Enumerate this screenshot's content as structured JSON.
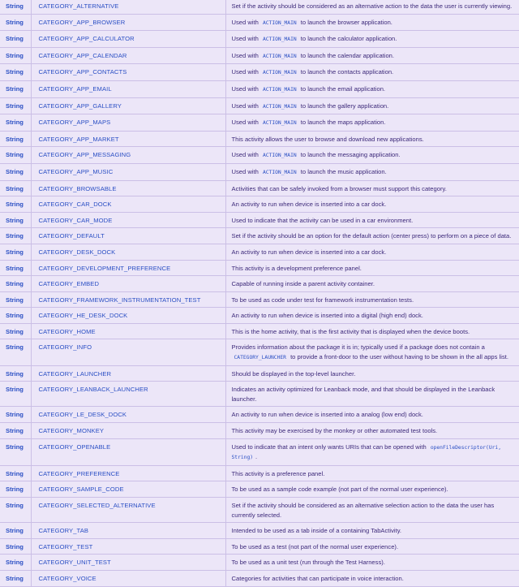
{
  "rows": [
    {
      "type": "String",
      "name": "CATEGORY_ALTERNATIVE",
      "desc": [
        "Set if the activity should be considered as an alternative action to the data the user is currently viewing."
      ]
    },
    {
      "type": "String",
      "name": "CATEGORY_APP_BROWSER",
      "desc": [
        "Used with ",
        {
          "code": "ACTION_MAIN"
        },
        " to launch the browser application."
      ]
    },
    {
      "type": "String",
      "name": "CATEGORY_APP_CALCULATOR",
      "desc": [
        "Used with ",
        {
          "code": "ACTION_MAIN"
        },
        " to launch the calculator application."
      ]
    },
    {
      "type": "String",
      "name": "CATEGORY_APP_CALENDAR",
      "desc": [
        "Used with ",
        {
          "code": "ACTION_MAIN"
        },
        " to launch the calendar application."
      ]
    },
    {
      "type": "String",
      "name": "CATEGORY_APP_CONTACTS",
      "desc": [
        "Used with ",
        {
          "code": "ACTION_MAIN"
        },
        " to launch the contacts application."
      ]
    },
    {
      "type": "String",
      "name": "CATEGORY_APP_EMAIL",
      "desc": [
        "Used with ",
        {
          "code": "ACTION_MAIN"
        },
        " to launch the email application."
      ]
    },
    {
      "type": "String",
      "name": "CATEGORY_APP_GALLERY",
      "desc": [
        "Used with ",
        {
          "code": "ACTION_MAIN"
        },
        " to launch the gallery application."
      ]
    },
    {
      "type": "String",
      "name": "CATEGORY_APP_MAPS",
      "desc": [
        "Used with ",
        {
          "code": "ACTION_MAIN"
        },
        " to launch the maps application."
      ]
    },
    {
      "type": "String",
      "name": "CATEGORY_APP_MARKET",
      "desc": [
        "This activity allows the user to browse and download new applications."
      ]
    },
    {
      "type": "String",
      "name": "CATEGORY_APP_MESSAGING",
      "desc": [
        "Used with ",
        {
          "code": "ACTION_MAIN"
        },
        " to launch the messaging application."
      ]
    },
    {
      "type": "String",
      "name": "CATEGORY_APP_MUSIC",
      "desc": [
        "Used with ",
        {
          "code": "ACTION_MAIN"
        },
        " to launch the music application."
      ]
    },
    {
      "type": "String",
      "name": "CATEGORY_BROWSABLE",
      "desc": [
        "Activities that can be safely invoked from a browser must support this category."
      ]
    },
    {
      "type": "String",
      "name": "CATEGORY_CAR_DOCK",
      "desc": [
        "An activity to run when device is inserted into a car dock."
      ]
    },
    {
      "type": "String",
      "name": "CATEGORY_CAR_MODE",
      "desc": [
        "Used to indicate that the activity can be used in a car environment."
      ]
    },
    {
      "type": "String",
      "name": "CATEGORY_DEFAULT",
      "desc": [
        "Set if the activity should be an option for the default action (center press) to perform on a piece of data."
      ]
    },
    {
      "type": "String",
      "name": "CATEGORY_DESK_DOCK",
      "desc": [
        "An activity to run when device is inserted into a car dock."
      ]
    },
    {
      "type": "String",
      "name": "CATEGORY_DEVELOPMENT_PREFERENCE",
      "desc": [
        "This activity is a development preference panel."
      ]
    },
    {
      "type": "String",
      "name": "CATEGORY_EMBED",
      "desc": [
        "Capable of running inside a parent activity container."
      ]
    },
    {
      "type": "String",
      "name": "CATEGORY_FRAMEWORK_INSTRUMENTATION_TEST",
      "desc": [
        "To be used as code under test for framework instrumentation tests."
      ]
    },
    {
      "type": "String",
      "name": "CATEGORY_HE_DESK_DOCK",
      "desc": [
        "An activity to run when device is inserted into a digital (high end) dock."
      ]
    },
    {
      "type": "String",
      "name": "CATEGORY_HOME",
      "desc": [
        "This is the home activity, that is the first activity that is displayed when the device boots."
      ]
    },
    {
      "type": "String",
      "name": "CATEGORY_INFO",
      "desc": [
        "Provides information about the package it is in; typically used if a package does not contain a ",
        {
          "code": "CATEGORY_LAUNCHER"
        },
        " to provide a front-door to the user without having to be shown in the all apps list."
      ]
    },
    {
      "type": "String",
      "name": "CATEGORY_LAUNCHER",
      "desc": [
        "Should be displayed in the top-level launcher."
      ]
    },
    {
      "type": "String",
      "name": "CATEGORY_LEANBACK_LAUNCHER",
      "desc": [
        "Indicates an activity optimized for Leanback mode, and that should be displayed in the Leanback launcher."
      ]
    },
    {
      "type": "String",
      "name": "CATEGORY_LE_DESK_DOCK",
      "desc": [
        "An activity to run when device is inserted into a analog (low end) dock."
      ]
    },
    {
      "type": "String",
      "name": "CATEGORY_MONKEY",
      "desc": [
        "This activity may be exercised by the monkey or other automated test tools."
      ]
    },
    {
      "type": "String",
      "name": "CATEGORY_OPENABLE",
      "desc": [
        "Used to indicate that an intent only wants URIs that can be opened with ",
        {
          "code": "openFileDescriptor(Uri, String)"
        },
        "."
      ]
    },
    {
      "type": "String",
      "name": "CATEGORY_PREFERENCE",
      "desc": [
        "This activity is a preference panel."
      ]
    },
    {
      "type": "String",
      "name": "CATEGORY_SAMPLE_CODE",
      "desc": [
        "To be used as a sample code example (not part of the normal user experience)."
      ]
    },
    {
      "type": "String",
      "name": "CATEGORY_SELECTED_ALTERNATIVE",
      "desc": [
        "Set if the activity should be considered as an alternative selection action to the data the user has currently selected."
      ]
    },
    {
      "type": "String",
      "name": "CATEGORY_TAB",
      "desc": [
        "Intended to be used as a tab inside of a containing TabActivity."
      ]
    },
    {
      "type": "String",
      "name": "CATEGORY_TEST",
      "desc": [
        "To be used as a test (not part of the normal user experience)."
      ]
    },
    {
      "type": "String",
      "name": "CATEGORY_UNIT_TEST",
      "desc": [
        "To be used as a unit test (run through the Test Harness)."
      ]
    },
    {
      "type": "String",
      "name": "CATEGORY_VOICE",
      "desc": [
        "Categories for activities that can participate in voice interaction."
      ]
    }
  ]
}
